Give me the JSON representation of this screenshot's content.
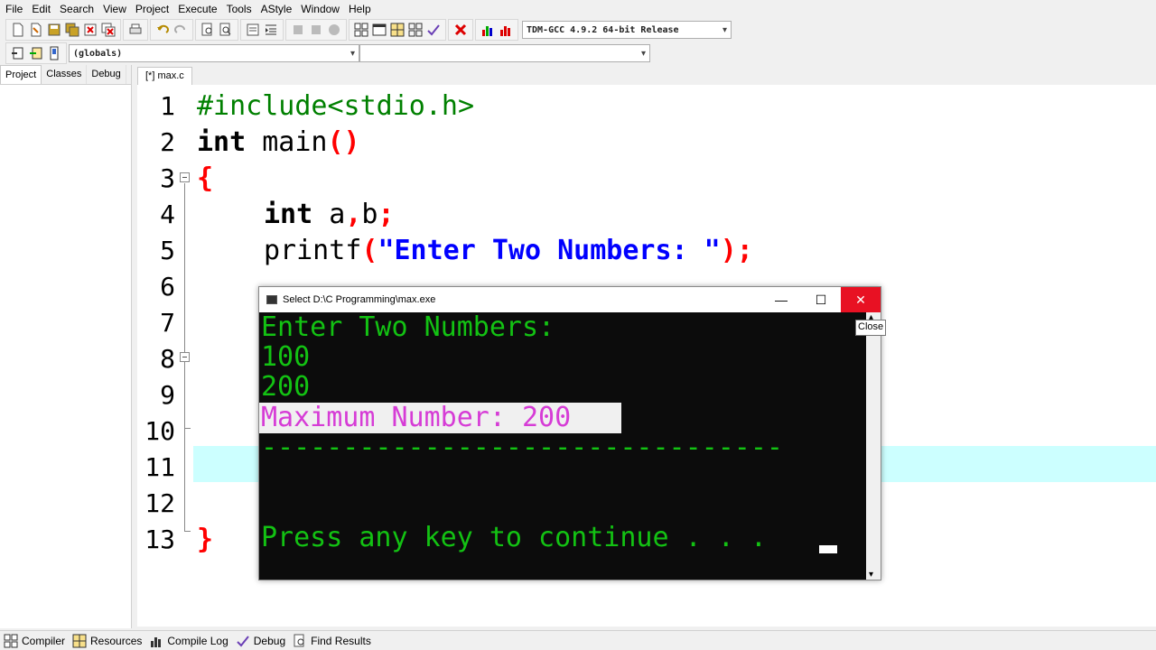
{
  "menu": [
    "File",
    "Edit",
    "Search",
    "View",
    "Project",
    "Execute",
    "Tools",
    "AStyle",
    "Window",
    "Help"
  ],
  "compiler_select": "TDM-GCC 4.9.2 64-bit Release",
  "scope_select": "(globals)",
  "scope_select2": "",
  "left_tabs": [
    "Project",
    "Classes",
    "Debug"
  ],
  "editor_tab": "[*] max.c",
  "line_numbers": [
    "1",
    "2",
    "3",
    "4",
    "5",
    "6",
    "7",
    "8",
    "9",
    "10",
    "11",
    "12",
    "13"
  ],
  "code": {
    "l1": "#include<stdio.h>",
    "l2_kw": "int",
    "l2_rest": " main",
    "l2_paren": "()",
    "l3": "{",
    "l4_kw": "int",
    "l4_rest": " a",
    "l4_comma": ",",
    "l4_b": "b",
    "l4_semi": ";",
    "l5_fn": "printf",
    "l5_open": "(",
    "l5_str": "\"Enter Two Numbers: \"",
    "l5_close": ");",
    "l13": "}"
  },
  "console": {
    "title": "Select D:\\C Programming\\max.exe",
    "lines": [
      "Enter Two Numbers:",
      "100",
      "200",
      "Maximum Number: 200",
      "--------------------------------",
      "Press any key to continue . . ."
    ],
    "minimize": "—",
    "maximize": "☐",
    "close": "✕"
  },
  "tooltip": "Close",
  "status_items": [
    "Compiler",
    "Resources",
    "Compile Log",
    "Debug",
    "Find Results"
  ],
  "colors": {
    "console_green": "#13c213",
    "console_magenta": "#d63cd6",
    "current_line": "#ccffff",
    "close_red": "#e81123"
  }
}
